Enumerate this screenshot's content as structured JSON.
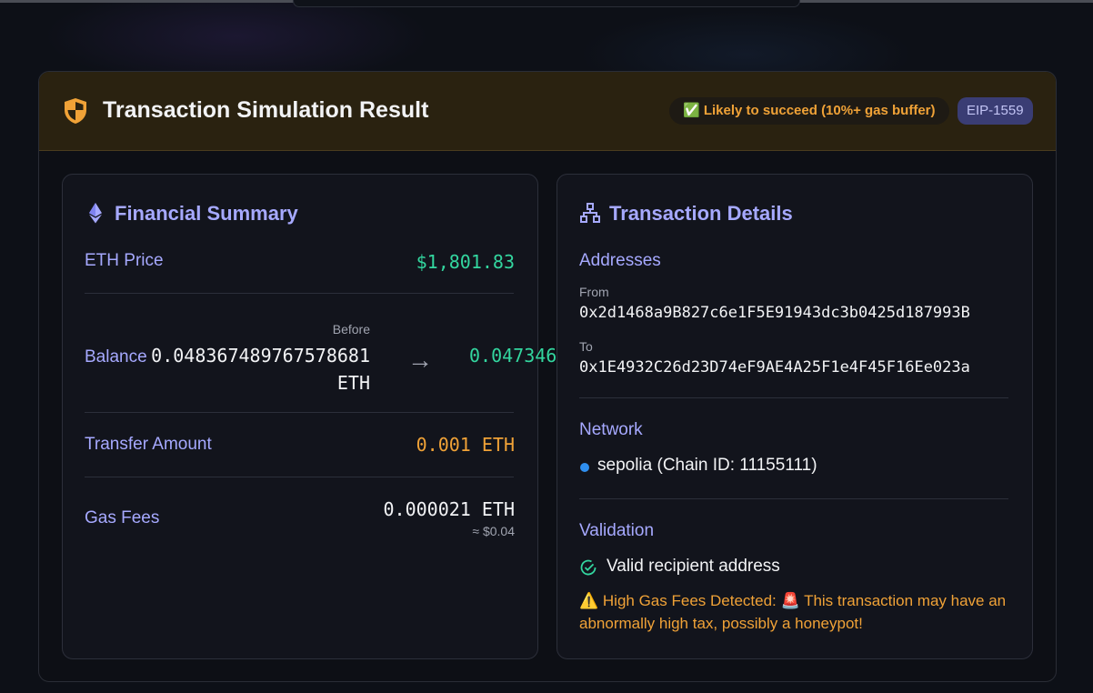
{
  "header": {
    "title": "Transaction Simulation Result",
    "status_pill": "✅ Likely to succeed (10%+ gas buffer)",
    "type_pill": "EIP-1559"
  },
  "financial": {
    "title": "Financial Summary",
    "eth_price_label": "ETH Price",
    "eth_price_value": "$1,801.83",
    "balance_label": "Balance",
    "before_label": "Before",
    "before_value": "0.048367489767578681 ETH",
    "arrow": "→",
    "after_value": "0.047346",
    "transfer_label": "Transfer Amount",
    "transfer_value": "0.001 ETH",
    "gas_label": "Gas Fees",
    "gas_value": "0.000021 ETH",
    "gas_usd": "≈ $0.04"
  },
  "details": {
    "title": "Transaction Details",
    "addresses_label": "Addresses",
    "from_label": "From",
    "from_value": "0x2d1468a9B827c6e1F5E91943dc3b0425d187993B",
    "to_label": "To",
    "to_value": "0x1E4932C26d23D74eF9AE4A25F1e4F45F16Ee023a",
    "network_label": "Network",
    "network_value": "sepolia (Chain ID: 11155111)",
    "validation_label": "Validation",
    "valid_text": "Valid recipient address",
    "warning_text": "⚠️ High Gas Fees Detected: 🚨 This transaction may have an abnormally high tax, possibly a honeypot!"
  },
  "colors": {
    "accent": "#a6a9ff",
    "success": "#33d69f",
    "warning": "#f0a237",
    "network_dot": "#2f8ff0",
    "header_bg": "#2a2210"
  },
  "icons": {
    "header": "shield-half-icon",
    "financial": "ethereum-icon",
    "details": "network-tree-icon",
    "valid": "check-circle-icon"
  }
}
